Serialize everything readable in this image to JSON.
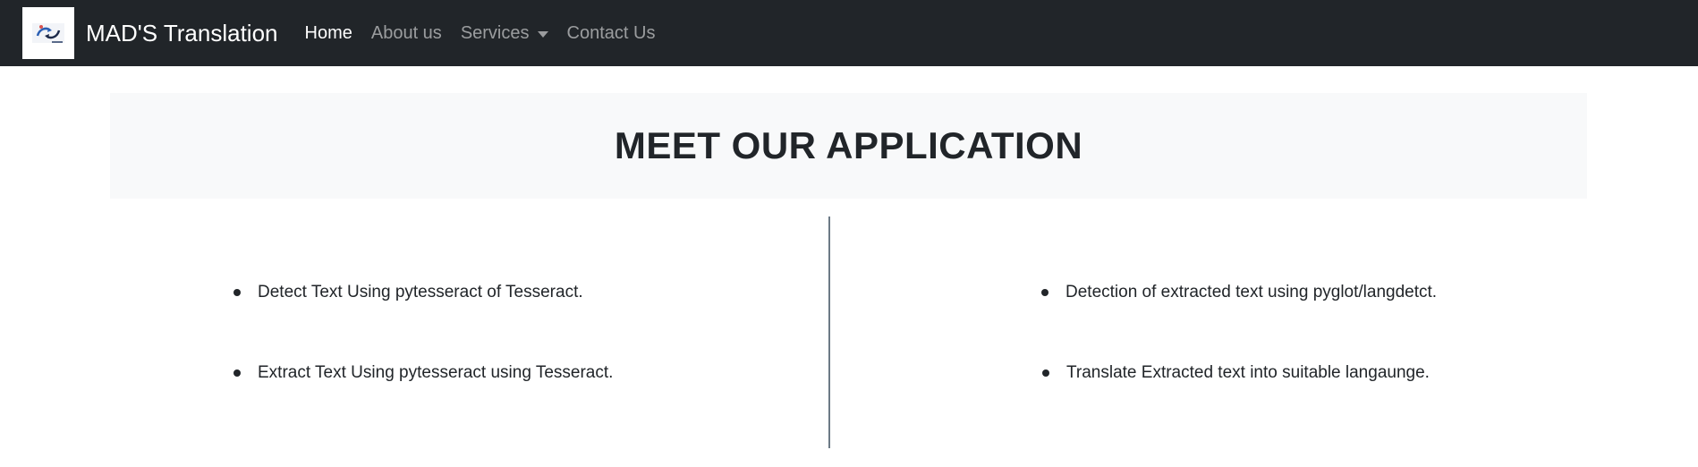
{
  "navbar": {
    "brand_name": "MAD'S Translation",
    "logo_icon": "translation-logo-icon",
    "links": [
      {
        "label": "Home",
        "active": true
      },
      {
        "label": "About us",
        "active": false
      },
      {
        "label": "Services",
        "active": false,
        "dropdown": true
      },
      {
        "label": "Contact Us",
        "active": false
      }
    ]
  },
  "hero": {
    "title": "MEET OUR APPLICATION"
  },
  "features": {
    "left": [
      "Detect Text Using pytesseract of Tesseract.",
      "Extract Text Using pytesseract using Tesseract."
    ],
    "right": [
      "Detection of extracted text using pyglot/langdetct.",
      "Translate Extracted text into suitable langaunge."
    ]
  },
  "colors": {
    "navbar_bg": "#212529",
    "hero_bg": "#f8f9fa",
    "divider": "#6c7a86"
  }
}
